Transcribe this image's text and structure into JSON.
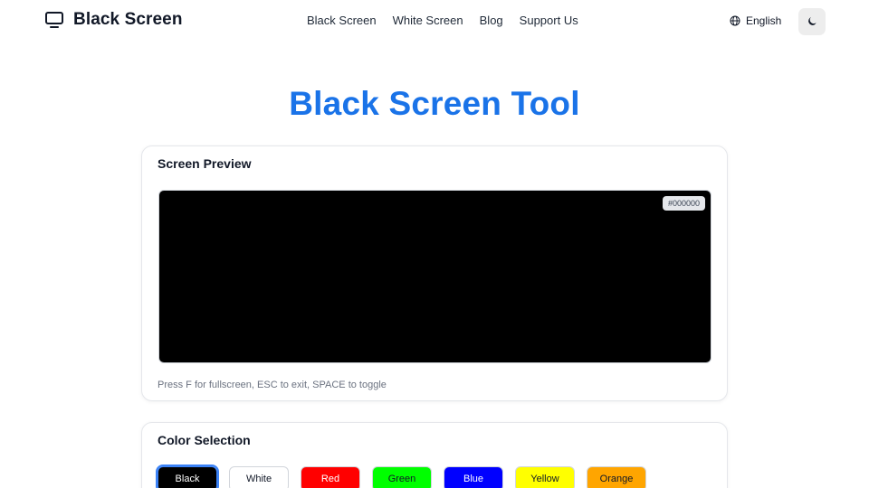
{
  "header": {
    "brand_icon": "monitor-icon",
    "brand_title": "Black Screen",
    "nav": [
      "Black Screen",
      "White Screen",
      "Blog",
      "Support Us"
    ],
    "language_icon": "globe-icon",
    "language": "English",
    "theme_icon": "moon-icon"
  },
  "main": {
    "title": "Black Screen Tool",
    "title_color": "#1a73e8"
  },
  "preview": {
    "title": "Screen Preview",
    "screen_color": "#000000",
    "hex_label": "#000000",
    "hint": "Press F for fullscreen, ESC to exit, SPACE to toggle"
  },
  "color_selection": {
    "title": "Color Selection",
    "selected": "Black",
    "swatches": [
      {
        "label": "Black",
        "bg": "#000000",
        "text": "#ffffff"
      },
      {
        "label": "White",
        "bg": "#ffffff",
        "text": "#111827"
      },
      {
        "label": "Red",
        "bg": "#ff0000",
        "text": "#ffffff"
      },
      {
        "label": "Green",
        "bg": "#00ff00",
        "text": "#111827"
      },
      {
        "label": "Blue",
        "bg": "#0000ff",
        "text": "#ffffff"
      },
      {
        "label": "Yellow",
        "bg": "#ffff00",
        "text": "#111827"
      },
      {
        "label": "Orange",
        "bg": "#ffa500",
        "text": "#111827"
      }
    ]
  }
}
